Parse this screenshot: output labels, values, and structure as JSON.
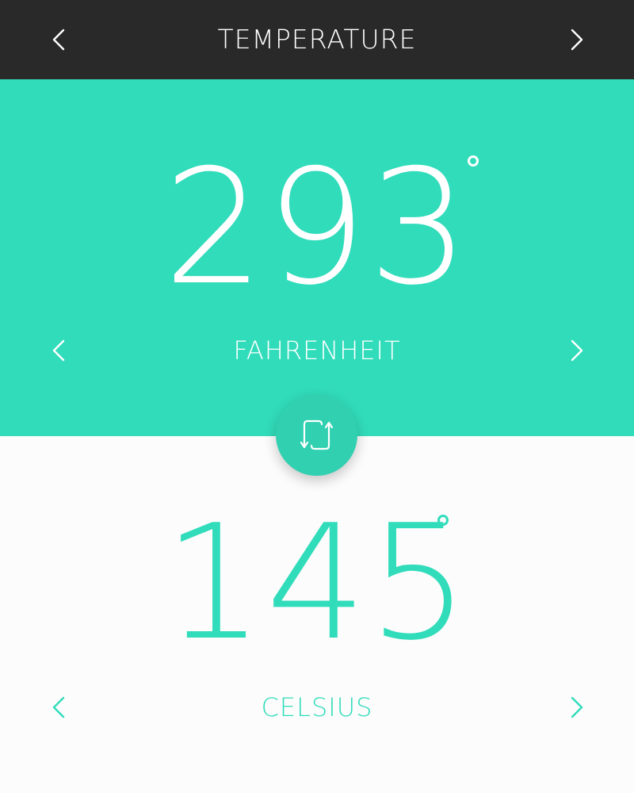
{
  "header": {
    "title": "TEMPERATURE",
    "back_icon": "chevron-left-icon",
    "forward_icon": "chevron-right-icon"
  },
  "source": {
    "value": "293",
    "unit": "FAHRENHEIT"
  },
  "swap": {
    "icon": "swap-arrows-icon"
  },
  "target": {
    "value": "145",
    "unit": "CELSIUS"
  },
  "colors": {
    "header_bg": "#292929",
    "accent": "#31dcbb",
    "background": "#fcfcfc",
    "text_light": "#ffffff"
  }
}
